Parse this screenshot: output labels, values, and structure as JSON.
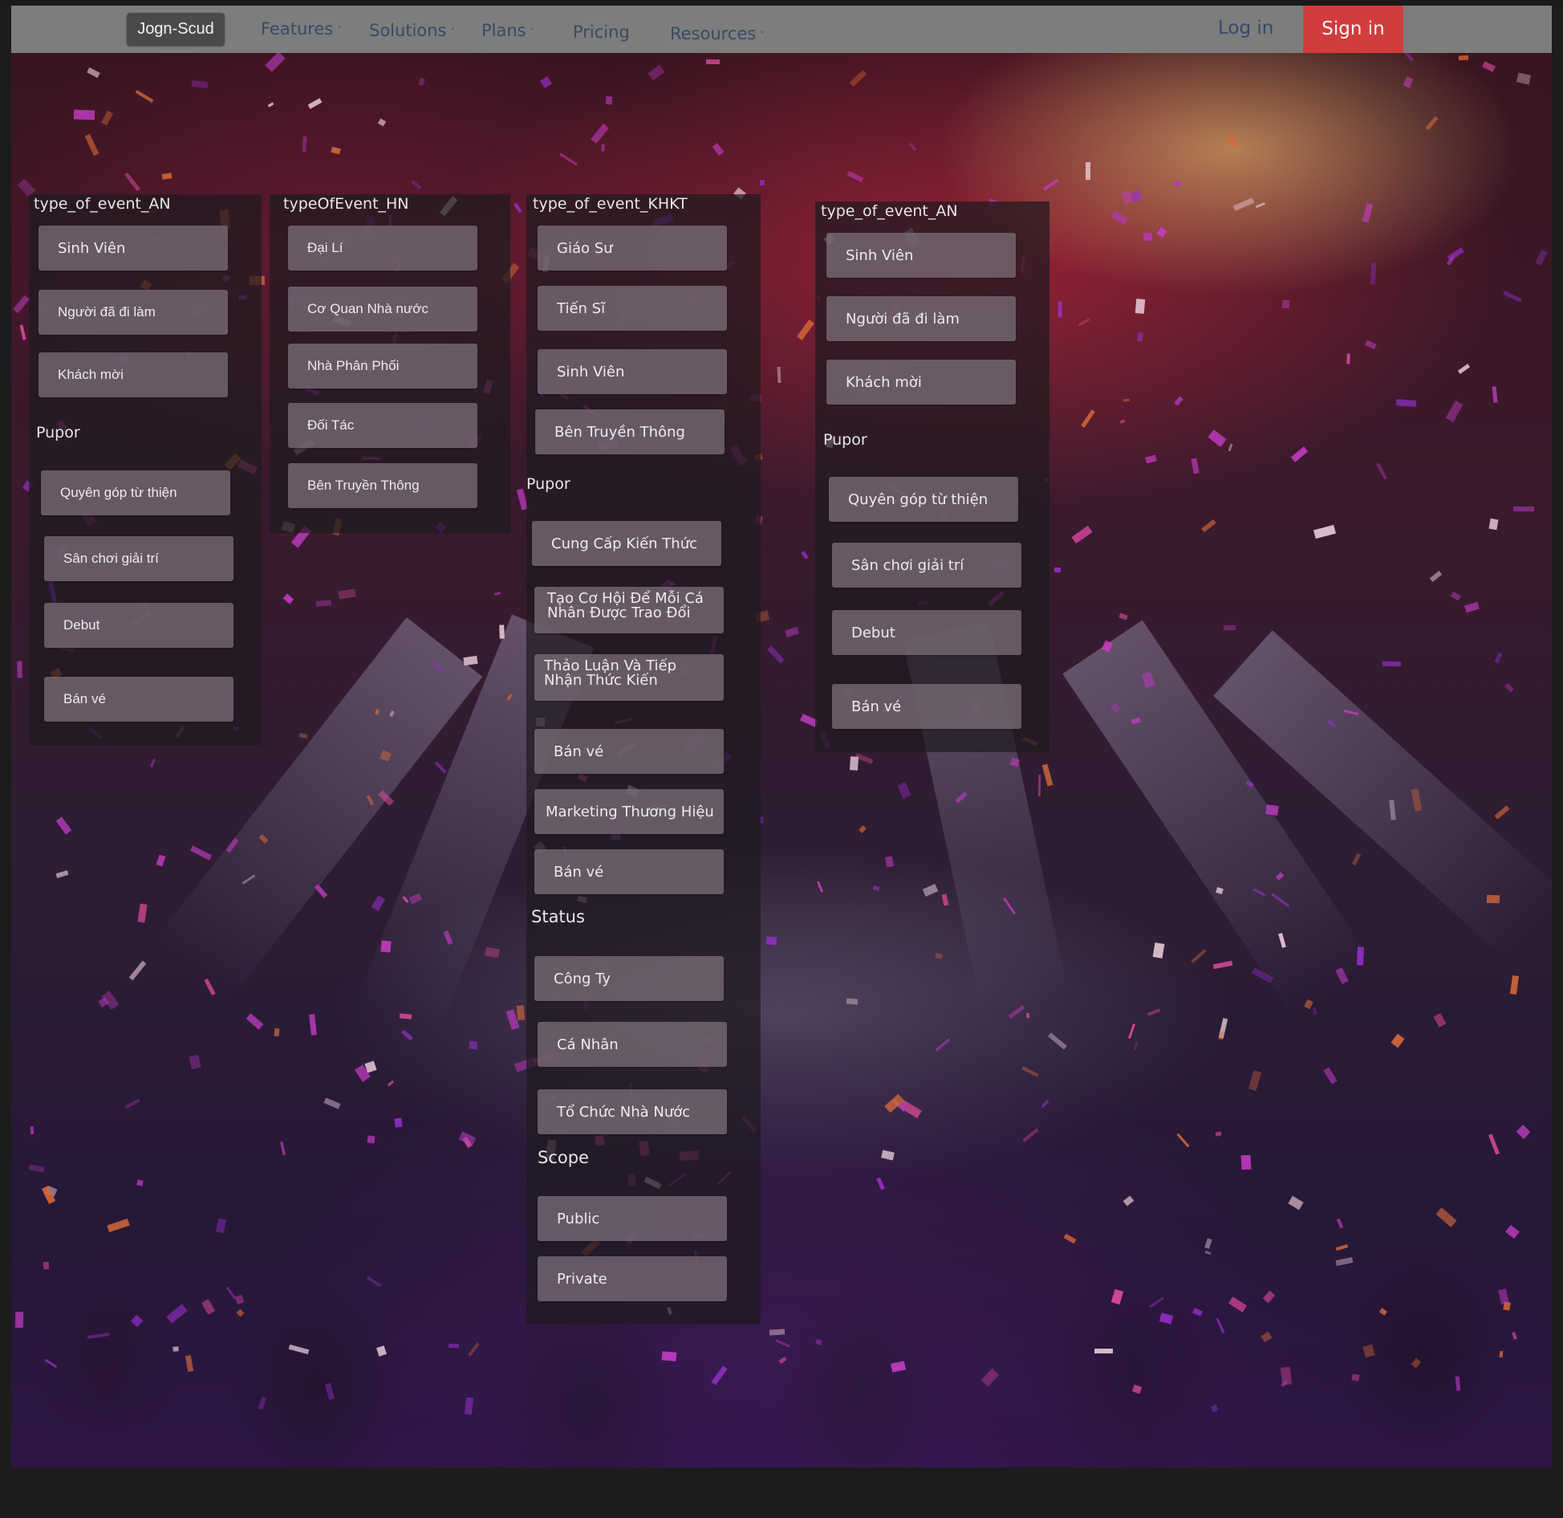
{
  "navbar": {
    "brand": "Jogn-Scud",
    "items": [
      {
        "label": "Features",
        "has_dropdown": true
      },
      {
        "label": "Solutions",
        "has_dropdown": true
      },
      {
        "label": "Plans",
        "has_dropdown": true
      },
      {
        "label": "Pricing",
        "has_dropdown": false
      },
      {
        "label": "Resources",
        "has_dropdown": true
      }
    ],
    "login": "Log in",
    "signin": "Sign in",
    "chevron": "˅"
  },
  "colors": {
    "navbar_bg": "#7d7d7d",
    "brand_bg": "#4a4a4a",
    "signin_bg": "#d23c3c",
    "nav_text": "#394a66",
    "chip_bg": "#786c76",
    "panel_bg": "#1e1a20"
  },
  "panels": {
    "an1": {
      "title": "type_of_event_AN",
      "types": [
        "Sinh Viên",
        "Người đã đi làm",
        "Khách mời"
      ],
      "pupor_label": "Pupor",
      "pupor": [
        "Quyên góp từ thiện",
        "Sân chơi giải trí",
        "Debut",
        "Bán vé"
      ]
    },
    "hn": {
      "title": "typeOfEvent_HN",
      "types": [
        "Đại Lí",
        "Cơ Quan Nhà nước",
        "Nhà Phân Phối",
        "Đối Tác",
        "Bên Truyền Thông"
      ]
    },
    "khkt": {
      "title": "type_of_event_KHKT",
      "types": [
        "Giáo Sư",
        "Tiến Sĩ",
        "Sinh Viên",
        "Bên Truyền Thông"
      ],
      "pupor_label": "Pupor",
      "pupor": [
        "Cung Cấp Kiến Thức",
        "Tạo Cơ Hội  Để Mỗi Cá Nhân Được Trao Đổi",
        "Thảo Luận Và Tiếp Nhận Thức Kiến",
        "Bán vé",
        "Marketing Thương Hiệu",
        "Bán vé"
      ],
      "status_label": "Status",
      "status": [
        "Công Ty",
        "Cá Nhân",
        "Tổ Chức Nhà Nước"
      ],
      "scope_label": "Scope",
      "scope": [
        "Public",
        "Private"
      ]
    },
    "an2": {
      "title": "type_of_event_AN",
      "types": [
        "Sinh Viên",
        "Người đã đi làm",
        "Khách mời"
      ],
      "pupor_label": "Pupor",
      "pupor": [
        "Quyên góp từ thiện",
        "Sân chơi giải trí",
        "Debut",
        "Bán vé"
      ]
    }
  }
}
